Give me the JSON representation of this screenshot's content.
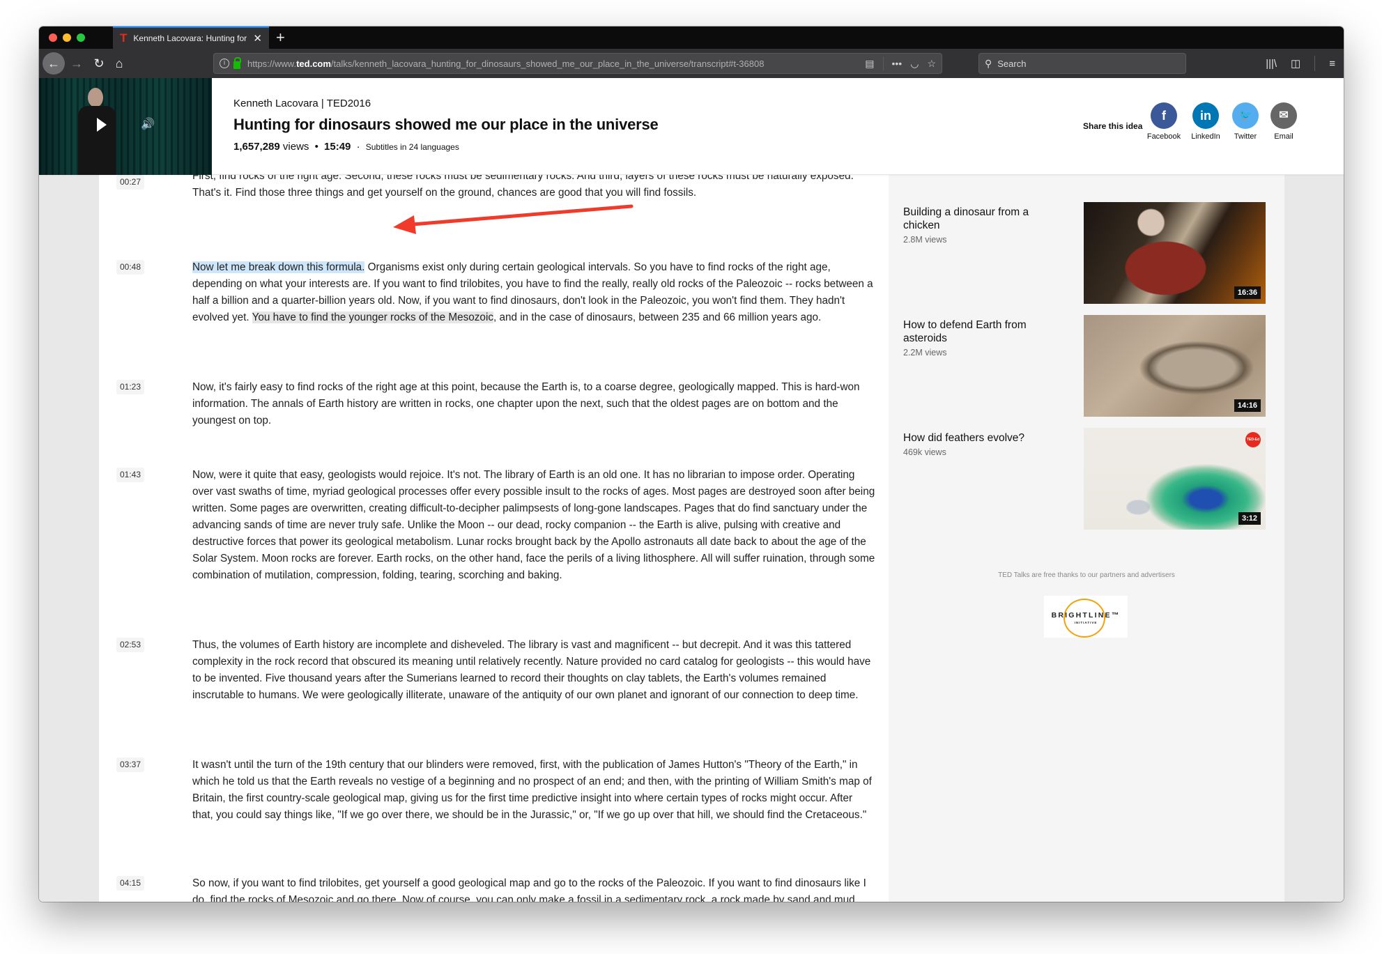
{
  "browser": {
    "traffic_lights": {
      "close_color": "#ff5f57",
      "minimize_color": "#febc2e",
      "zoom_color": "#28c840"
    },
    "tab": {
      "favicon": "T",
      "title": "Kenneth Lacovara: Hunting for dinosaurs showed me our place in the universe",
      "close_icon": "✕"
    },
    "new_tab_icon": "+",
    "nav": {
      "back": "←",
      "forward": "→",
      "reload": "↻",
      "home": "⌂"
    },
    "url": {
      "prefix": "https://www.",
      "domain": "ted.com",
      "path": "/talks/kenneth_lacovara_hunting_for_dinosaurs_showed_me_our_place_in_the_universe/transcript#t-36808"
    },
    "url_actions": {
      "reader": "▤",
      "more": "•••",
      "pocket": "◡",
      "bookmark": "☆"
    },
    "search": {
      "placeholder": "Search",
      "icon": "⚲"
    },
    "right_tools": {
      "library": "|||\\",
      "sidebar": "◫",
      "menu": "≡"
    }
  },
  "header": {
    "speaker_event": "Kenneth Lacovara | TED2016",
    "title": "Hunting for dinosaurs showed me our place in the universe",
    "views_count": "1,657,289",
    "views_label": "views",
    "separator": "•",
    "duration": "15:49",
    "separator2": "·",
    "subtitles": "Subtitles in 24 languages",
    "video": {
      "play_icon": "▶",
      "volume_icon": "🔊"
    },
    "share": {
      "label": "Share this idea",
      "buttons": [
        {
          "name": "Facebook",
          "glyph": "f",
          "color": "#3b5998"
        },
        {
          "name": "LinkedIn",
          "glyph": "in",
          "color": "#0077b5"
        },
        {
          "name": "Twitter",
          "glyph": "🐦",
          "color": "#55acee"
        },
        {
          "name": "Email",
          "glyph": "✉",
          "color": "#666666"
        }
      ]
    }
  },
  "transcript": [
    {
      "time": "00:27",
      "text": "First, find rocks of the right age. Second, these rocks must be sedimentary rocks. And third, layers of these rocks must be naturally exposed. That's it. Find those three things and get yourself on the ground, chances are good that you will find fossils."
    },
    {
      "time": "00:48",
      "highlight_blue": "Now let me break down this formula.",
      "text_a": " Organisms exist only during certain geological intervals. So you have to find rocks of the right age, depending on what your interests are. If you want to find trilobites, you have to find the really, really old rocks of the Paleozoic -- rocks between a half a billion and a quarter-billion years old. Now, if you want to find dinosaurs, don't look in the Paleozoic, you won't find them. They hadn't evolved yet. ",
      "highlight_gray": "You have to find the younger rocks of the Mesozoic",
      "text_b": ", and in the case of dinosaurs, between 235 and 66 million years ago."
    },
    {
      "time": "01:23",
      "text": "Now, it's fairly easy to find rocks of the right age at this point, because the Earth is, to a coarse degree, geologically mapped. This is hard-won information. The annals of Earth history are written in rocks, one chapter upon the next, such that the oldest pages are on bottom and the youngest on top."
    },
    {
      "time": "01:43",
      "text": "Now, were it quite that easy, geologists would rejoice. It's not. The library of Earth is an old one. It has no librarian to impose order. Operating over vast swaths of time, myriad geological processes offer every possible insult to the rocks of ages. Most pages are destroyed soon after being written. Some pages are overwritten, creating difficult-to-decipher palimpsests of long-gone landscapes. Pages that do find sanctuary under the advancing sands of time are never truly safe. Unlike the Moon -- our dead, rocky companion -- the Earth is alive, pulsing with creative and destructive forces that power its geological metabolism. Lunar rocks brought back by the Apollo astronauts all date back to about the age of the Solar System. Moon rocks are forever. Earth rocks, on the other hand, face the perils of a living lithosphere. All will suffer ruination, through some combination of mutilation, compression, folding, tearing, scorching and baking."
    },
    {
      "time": "02:53",
      "text": "Thus, the volumes of Earth history are incomplete and disheveled. The library is vast and magnificent -- but decrepit. And it was this tattered complexity in the rock record that obscured its meaning until relatively recently. Nature provided no card catalog for geologists -- this would have to be invented. Five thousand years after the Sumerians learned to record their thoughts on clay tablets, the Earth's volumes remained inscrutable to humans. We were geologically illiterate, unaware of the antiquity of our own planet and ignorant of our connection to deep time."
    },
    {
      "time": "03:37",
      "text": "It wasn't until the turn of the 19th century that our blinders were removed, first, with the publication of James Hutton's \"Theory of the Earth,\" in which he told us that the Earth reveals no vestige of a beginning and no prospect of an end; and then, with the printing of William Smith's map of Britain, the first country-scale geological map, giving us for the first time predictive insight into where certain types of rocks might occur. After that, you could say things like, \"If we go over there, we should be in the Jurassic,\" or, \"If we go up over that hill, we should find the Cretaceous.\""
    },
    {
      "time": "04:15",
      "text": "So now, if you want to find trilobites, get yourself a good geological map and go to the rocks of the Paleozoic. If you want to find dinosaurs like I do, find the rocks of Mesozoic and go there. Now of course, you can only make a fossil in a sedimentary rock, a rock made by sand and mud. You can't have a fossil in an igneous rock formed by magma, like a granite, or in a metamorphic rock that's been heated and squeezed so hard."
    }
  ],
  "related": [
    {
      "title": "Building a dinosaur from a chicken",
      "views": "2.8M views",
      "duration": "16:36"
    },
    {
      "title": "How to defend Earth from asteroids",
      "views": "2.2M views",
      "duration": "14:16"
    },
    {
      "title": "How did feathers evolve?",
      "views": "469k views",
      "duration": "3:12",
      "badge": "TED-Ed"
    }
  ],
  "sponsor": {
    "note": "TED Talks are free thanks to our partners and advertisers",
    "logo_word": "BRIGHTLINE™",
    "logo_sub": "INITIATIVE"
  },
  "annotation": {
    "arrow_color": "#f03a2a"
  }
}
